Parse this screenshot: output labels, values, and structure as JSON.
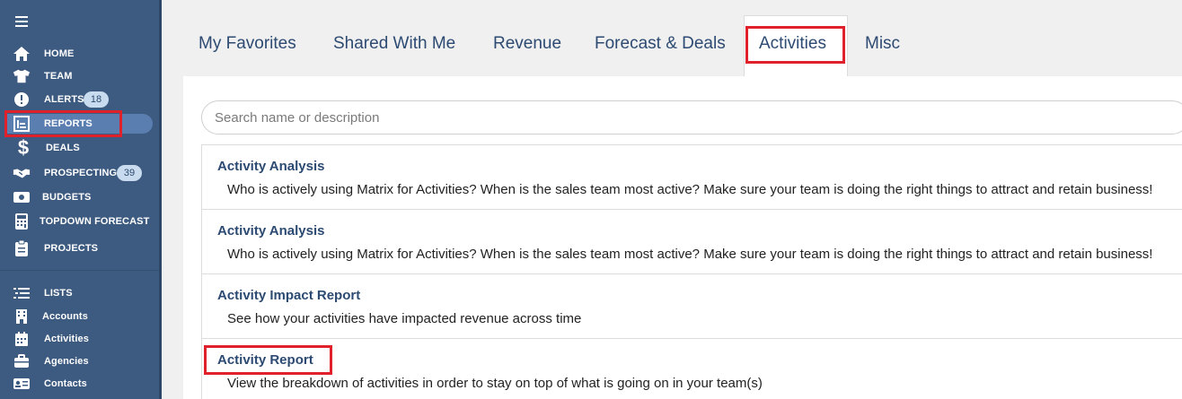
{
  "sidebar": {
    "main_items": [
      {
        "label": "HOME",
        "icon": "home-icon"
      },
      {
        "label": "TEAM",
        "icon": "team-shirt-icon"
      },
      {
        "label": "ALERTS",
        "icon": "alert-icon",
        "badge": "18"
      },
      {
        "label": "REPORTS",
        "icon": "reports-icon",
        "active": true
      },
      {
        "label": "DEALS",
        "icon": "dollar-icon"
      },
      {
        "label": "PROSPECTING",
        "icon": "handshake-icon",
        "badge": "39"
      },
      {
        "label": "BUDGETS",
        "icon": "budget-icon"
      },
      {
        "label": "TOPDOWN FORECAST",
        "icon": "calculator-icon"
      },
      {
        "label": "PROJECTS",
        "icon": "clipboard-icon"
      }
    ],
    "list_items": [
      {
        "label": "LISTS",
        "icon": "list-icon"
      },
      {
        "label": "Accounts",
        "icon": "building-icon"
      },
      {
        "label": "Activities",
        "icon": "calendar-icon"
      },
      {
        "label": "Agencies",
        "icon": "briefcase-icon"
      },
      {
        "label": "Contacts",
        "icon": "contact-card-icon"
      }
    ]
  },
  "tabs": [
    {
      "label": "My Favorites"
    },
    {
      "label": "Shared With Me"
    },
    {
      "label": "Revenue"
    },
    {
      "label": "Forecast & Deals"
    },
    {
      "label": "Activities",
      "active": true
    },
    {
      "label": "Misc"
    }
  ],
  "search": {
    "placeholder": "Search name or description",
    "value": ""
  },
  "reports": [
    {
      "title": "Activity Analysis",
      "description": "Who is actively using Matrix for Activities? When is the sales team most active? Make sure your team is doing the right things to attract and retain business!"
    },
    {
      "title": "Activity Analysis",
      "description": "Who is actively using Matrix for Activities? When is the sales team most active? Make sure your team is doing the right things to attract and retain business!"
    },
    {
      "title": "Activity Impact Report",
      "description": "See how your activities have impacted revenue across time"
    },
    {
      "title": "Activity Report",
      "description": "View the breakdown of activities in order to stay on top of what is going on in your team(s)"
    }
  ],
  "colors": {
    "sidebar": "#3d5a80",
    "accent": "#2c4a72",
    "highlight": "#e0202a",
    "badge": "#c9dbef"
  }
}
